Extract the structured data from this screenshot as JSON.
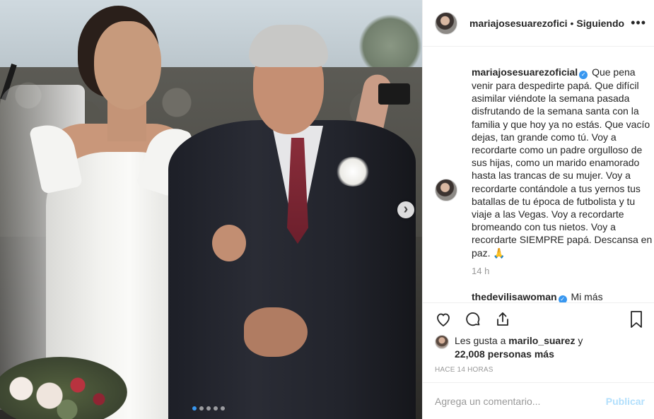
{
  "post": {
    "username": "mariajosesuarezofici",
    "separator": "•",
    "follow_state": "Siguiendo",
    "more_label": "•••"
  },
  "caption": {
    "username": "mariajosesuarezoficial",
    "verified_mark": "✓",
    "text": "Que pena venir para despedirte papá. Que difícil asimilar viéndote la semana pasada disfrutando de la semana santa con la familia y que hoy ya no estás. Que vacío dejas, tan grande como tú. Voy a recordarte como un padre orgulloso de sus hijas, como un marido enamorado hasta las trancas de su mujer. Voy a recordarte contándole a tus yernos tus batallas de tu época de futbolista y tu viaje a las Vegas. Voy a recordarte bromeando con tus nietos. Voy a recordarte SIEMPRE papá. Descansa en paz. 🙏",
    "time": "14 h"
  },
  "next_comment": {
    "username": "thedevilisawoman",
    "text": "Mi más"
  },
  "likes": {
    "prefix": "Les gusta a",
    "user": "marilo_suarez",
    "conjunction": "y",
    "count": "22,008 personas más"
  },
  "time_ago": "HACE 14 HORAS",
  "add_comment": {
    "placeholder": "Agrega un comentario...",
    "post_label": "Publicar"
  },
  "carousel": {
    "next_glyph": "›",
    "dots": 5,
    "active_dot": 0
  }
}
